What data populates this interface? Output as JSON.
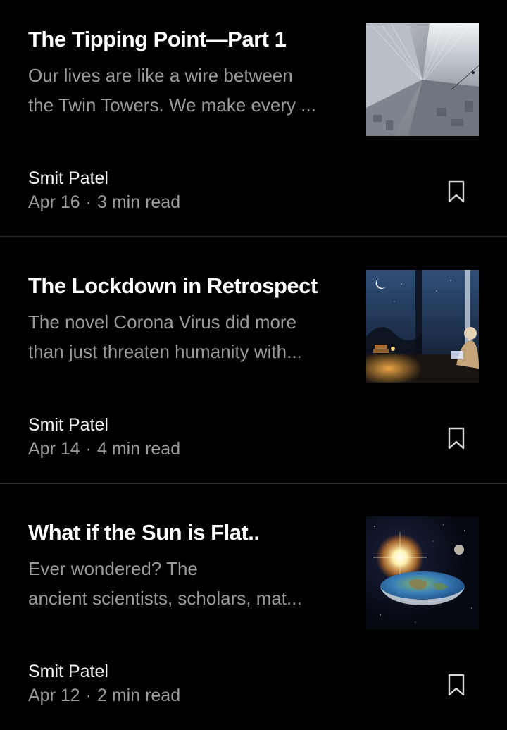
{
  "articles": [
    {
      "title": "The Tipping Point—Part 1",
      "excerpt_lines": [
        "Our lives are like a wire between",
        "the Twin Towers. We make every ..."
      ],
      "author": "Smit Patel",
      "date": "Apr 16",
      "read_time": "3 min read",
      "thumbnail": "skyscraper-aerial-image"
    },
    {
      "title": "The Lockdown in Retrospect",
      "excerpt_lines": [
        "The novel Corona Virus did more",
        "than just threaten humanity with..."
      ],
      "author": "Smit Patel",
      "date": "Apr 14",
      "read_time": "4 min read",
      "thumbnail": "child-reading-by-window-image"
    },
    {
      "title": "What if the Sun is Flat..",
      "excerpt_lines": [
        "Ever wondered? The",
        "ancient scientists, scholars, mat..."
      ],
      "author": "Smit Patel",
      "date": "Apr 12",
      "read_time": "2 min read",
      "thumbnail": "flat-earth-space-image"
    }
  ],
  "meta_separator": "·",
  "colors": {
    "background": "#000000",
    "title": "#ffffff",
    "secondary_text": "#9b9b9b",
    "divider": "#2a2a2a"
  }
}
